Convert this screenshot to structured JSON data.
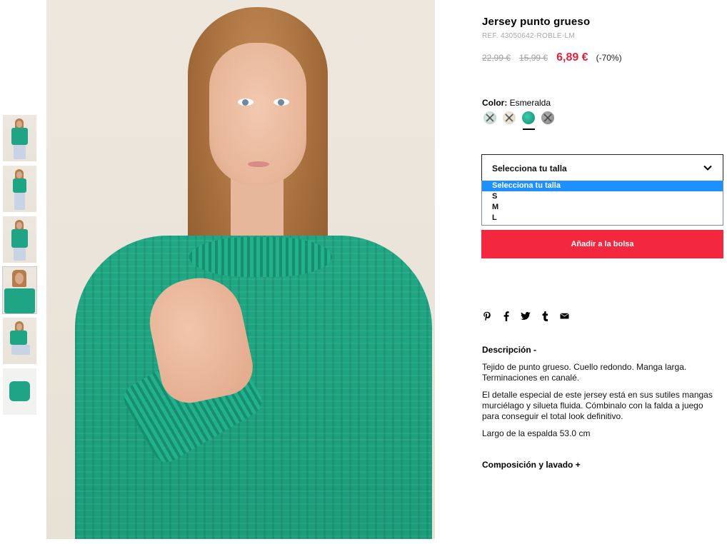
{
  "product": {
    "title": "Jersey punto grueso",
    "ref": "REF. 43050642-ROBLE-LM",
    "price_original": "22,99 €",
    "price_previous": "15,99 €",
    "price_current": "6,89 €",
    "discount": "(-70%)"
  },
  "color": {
    "label": "Color:",
    "selected": "Esmeralda",
    "swatches": [
      "light-mint-pattern",
      "cream-pattern",
      "emerald",
      "grey-unavailable"
    ]
  },
  "size": {
    "select_value": "Selecciona tu talla",
    "options": [
      "Selecciona tu talla",
      "S",
      "M",
      "L"
    ]
  },
  "add_to_bag": "Añadir a la bolsa",
  "share_icons": [
    "pinterest-icon",
    "facebook-icon",
    "twitter-icon",
    "tumblr-icon",
    "email-icon"
  ],
  "description": {
    "heading": "Descripción -",
    "paragraphs": [
      "Tejido de punto grueso. Cuello redondo. Manga larga. Terminaciones en canalé.",
      "El detalle especial de este jersey está en sus sutiles mangas murciélago y silueta fluida. Cómbinalo con la falda a juego para conseguir el total look definitivo.",
      "Largo de la espalda 53.0 cm"
    ]
  },
  "composition_heading": "Composición y lavado +",
  "colors": {
    "accent_red": "#f3273d",
    "price_red": "#e6213b",
    "dropdown_highlight": "#1e90ff",
    "sweater_green": "#1fa586"
  }
}
